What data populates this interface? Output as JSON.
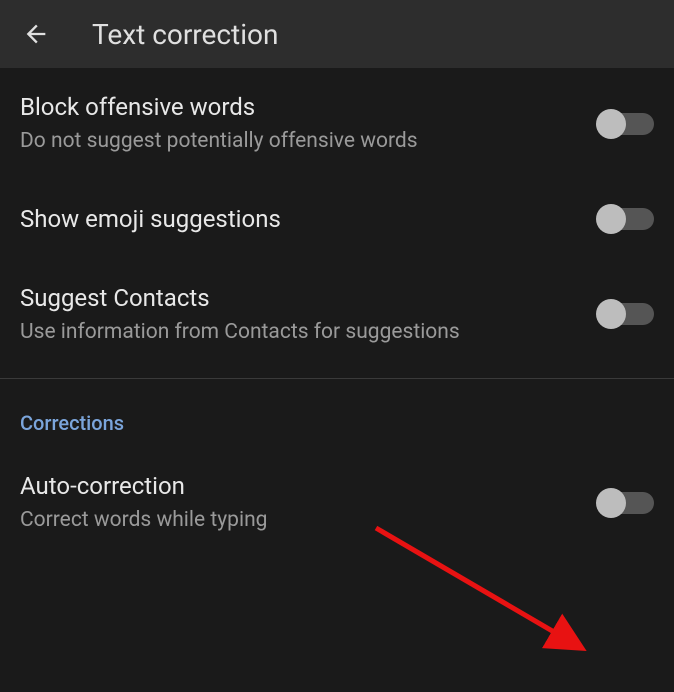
{
  "header": {
    "title": "Text correction"
  },
  "settings": [
    {
      "title": "Block offensive words",
      "subtitle": "Do not suggest potentially offensive words",
      "enabled": false
    },
    {
      "title": "Show emoji suggestions",
      "subtitle": "",
      "enabled": false
    },
    {
      "title": "Suggest Contacts",
      "subtitle": "Use information from Contacts for suggestions",
      "enabled": false
    }
  ],
  "section": {
    "label": "Corrections"
  },
  "corrections": [
    {
      "title": "Auto-correction",
      "subtitle": "Correct words while typing",
      "enabled": false
    }
  ]
}
